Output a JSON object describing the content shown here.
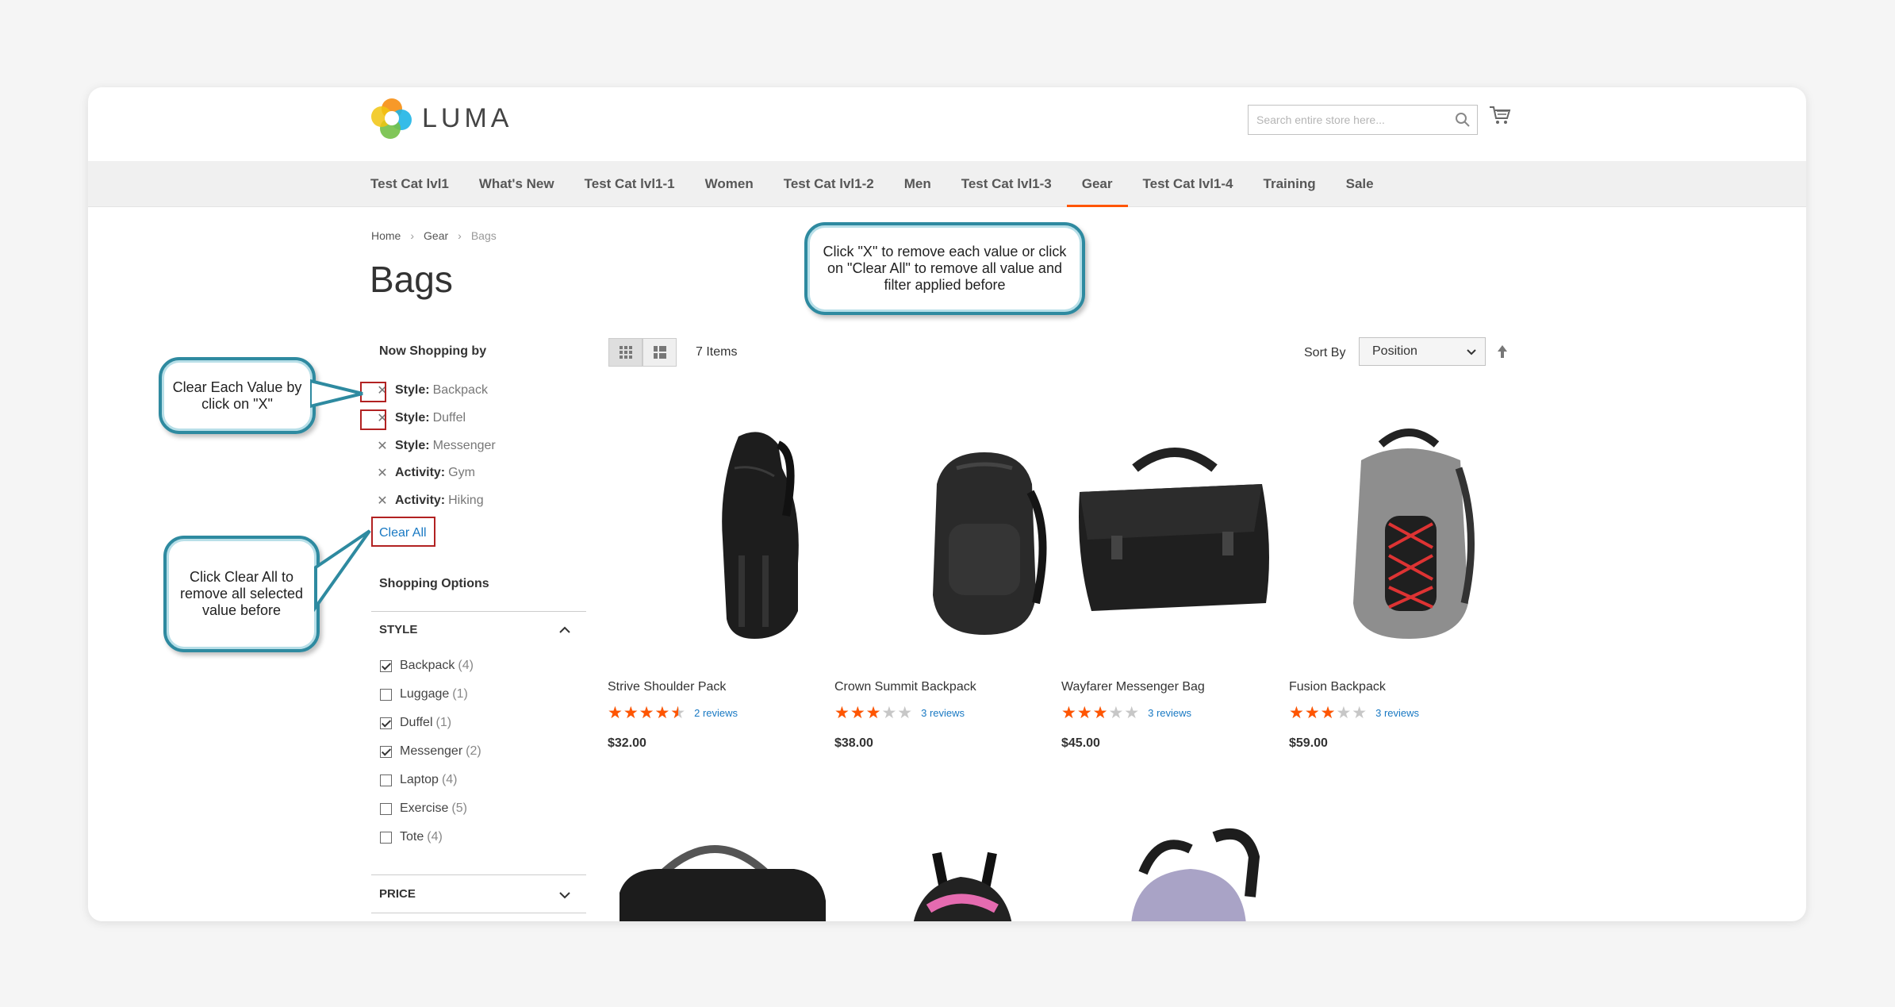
{
  "brand": {
    "name": "LUMA"
  },
  "search": {
    "placeholder": "Search entire store here..."
  },
  "nav": {
    "items": [
      "Test Cat lvl1",
      "What's New",
      "Test Cat lvl1-1",
      "Women",
      "Test Cat lvl1-2",
      "Men",
      "Test Cat lvl1-3",
      "Gear",
      "Test Cat lvl1-4",
      "Training",
      "Sale"
    ],
    "active": "Gear"
  },
  "breadcrumb": {
    "home": "Home",
    "gear": "Gear",
    "current": "Bags"
  },
  "page": {
    "title": "Bags"
  },
  "filters": {
    "heading": "Now Shopping by",
    "active": [
      {
        "key": "Style:",
        "value": "Backpack"
      },
      {
        "key": "Style:",
        "value": "Duffel"
      },
      {
        "key": "Style:",
        "value": "Messenger"
      },
      {
        "key": "Activity:",
        "value": "Gym"
      },
      {
        "key": "Activity:",
        "value": "Hiking"
      }
    ],
    "clear_all": "Clear All"
  },
  "options": {
    "heading": "Shopping Options",
    "style_title": "STYLE",
    "style_items": [
      {
        "label": "Backpack",
        "count": "(4)",
        "checked": true
      },
      {
        "label": "Luggage",
        "count": "(1)",
        "checked": false
      },
      {
        "label": "Duffel",
        "count": "(1)",
        "checked": true
      },
      {
        "label": "Messenger",
        "count": "(2)",
        "checked": true
      },
      {
        "label": "Laptop",
        "count": "(4)",
        "checked": false
      },
      {
        "label": "Exercise",
        "count": "(5)",
        "checked": false
      },
      {
        "label": "Tote",
        "count": "(4)",
        "checked": false
      }
    ],
    "price_title": "PRICE"
  },
  "toolbar": {
    "items_count": "7 Items",
    "sort_label": "Sort By",
    "sort_value": "Position"
  },
  "products": [
    {
      "name": "Strive Shoulder Pack",
      "rating": 0.9,
      "reviews": "2 reviews",
      "price": "$32.00"
    },
    {
      "name": "Crown Summit Backpack",
      "rating": 0.6,
      "reviews": "3 reviews",
      "price": "$38.00"
    },
    {
      "name": "Wayfarer Messenger Bag",
      "rating": 0.6,
      "reviews": "3 reviews",
      "price": "$45.00"
    },
    {
      "name": "Fusion Backpack",
      "rating": 0.6,
      "reviews": "3 reviews",
      "price": "$59.00"
    }
  ],
  "callouts": {
    "top": "Click \"X\" to remove each value or click on \"Clear All\" to remove all value and filter applied before",
    "clear_each": "Clear Each Value by click on \"X\"",
    "clear_all": "Click Clear All to remove all selected value before"
  },
  "colors": {
    "accent": "#ff5501",
    "link": "#1979c3",
    "callout_border": "#2e8aa0",
    "highlight_box": "#b22222"
  }
}
